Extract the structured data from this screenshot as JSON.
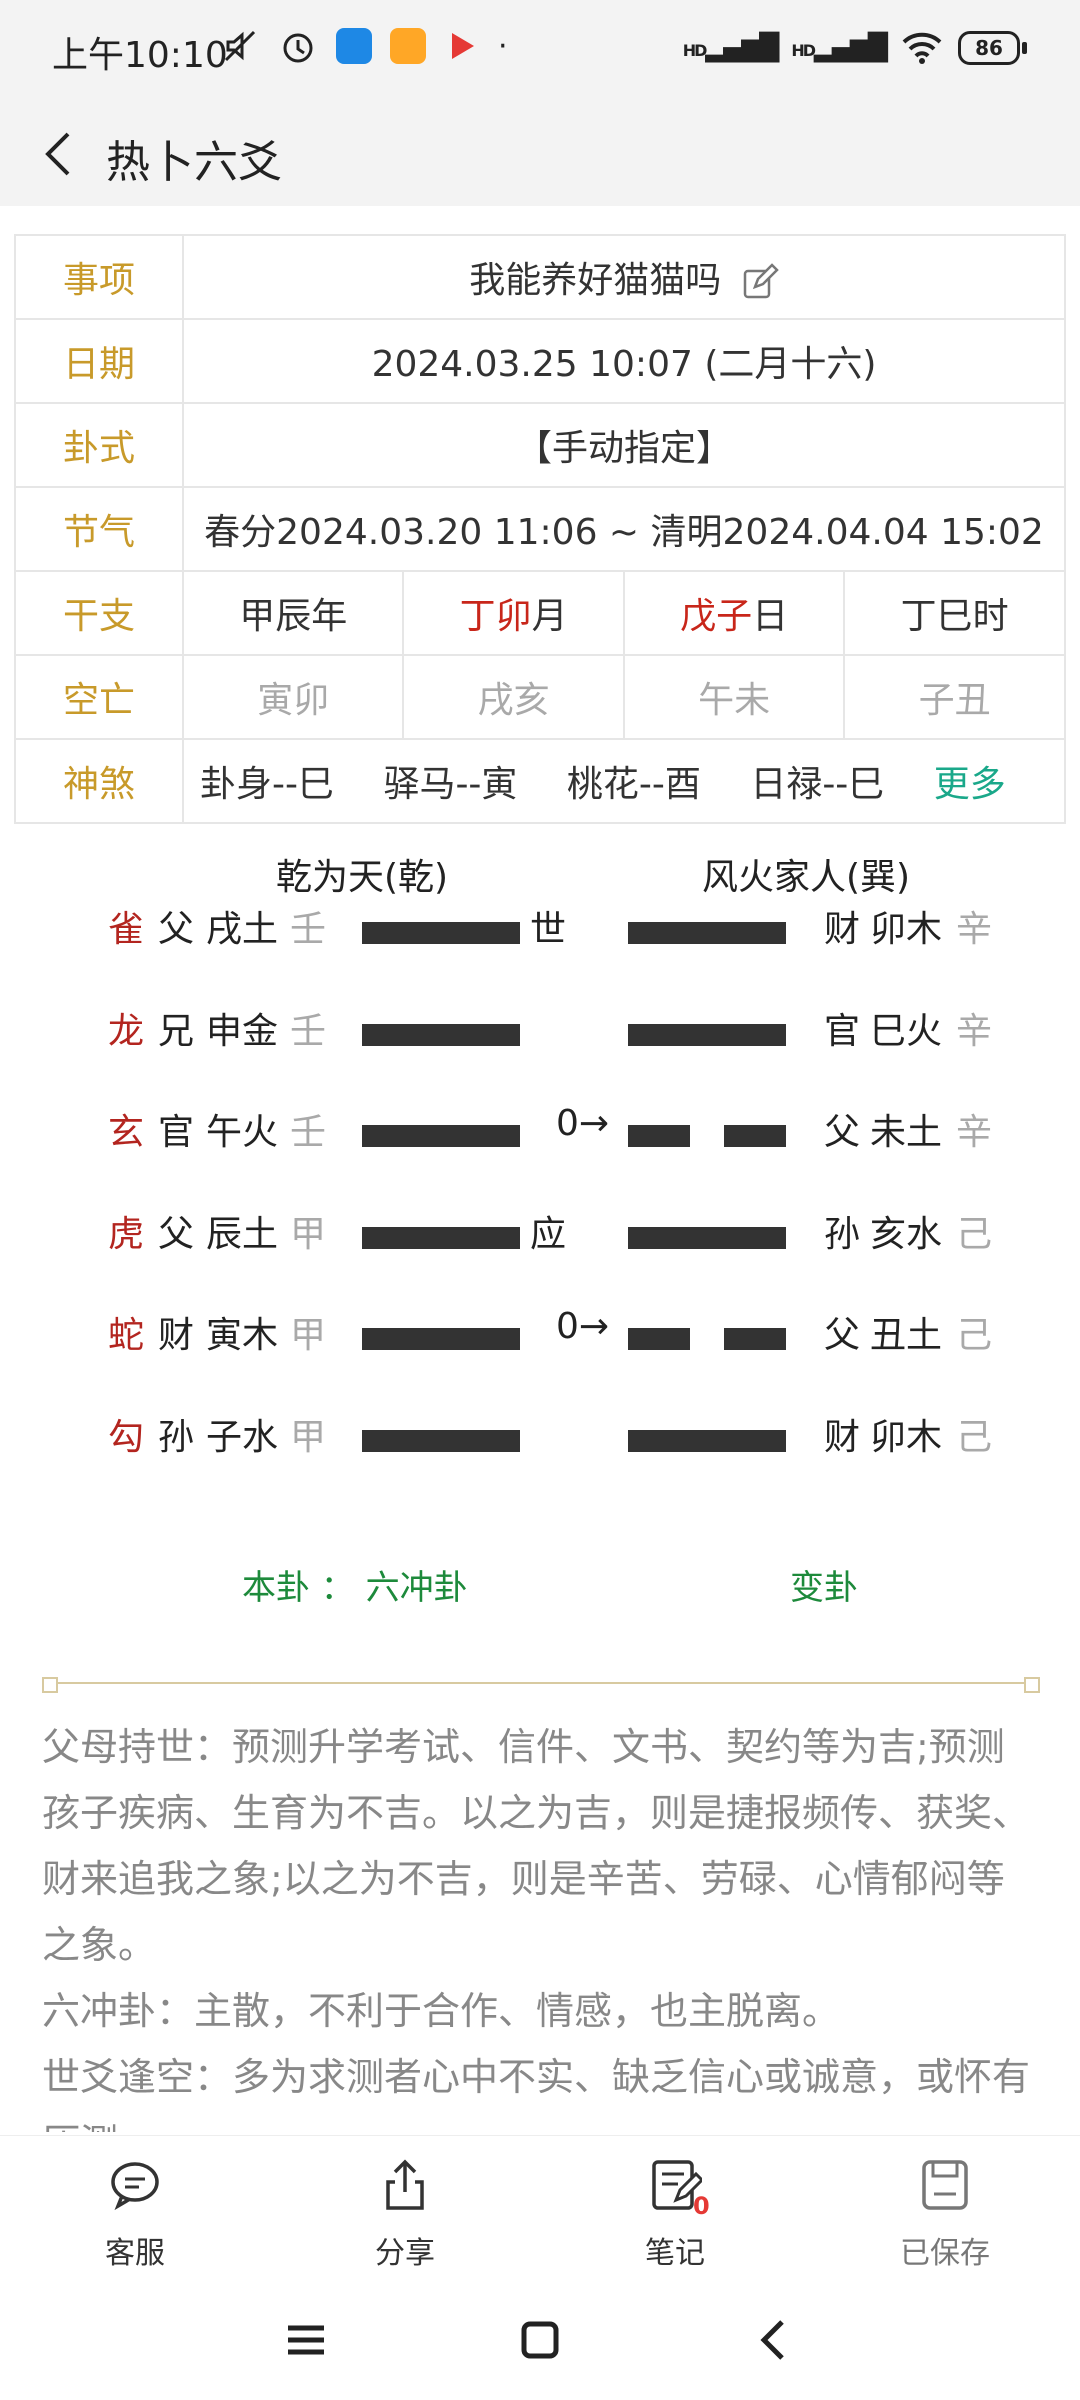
{
  "status_bar": {
    "time": "上午10:10",
    "battery": "86",
    "network": "HD"
  },
  "header": {
    "title": "热卜六爻"
  },
  "info": {
    "item_label": "事项",
    "item_value": "我能养好猫猫吗",
    "date_label": "日期",
    "date_value": "2024.03.25 10:07 (二月十六)",
    "method_label": "卦式",
    "method_value": "【手动指定】",
    "solar_label": "节气",
    "solar_value": "春分2024.03.20 11:06 ~ 清明2024.04.04 15:02",
    "ganzhi_label": "干支",
    "ganzhi": [
      {
        "gz": "甲辰",
        "suffix": "年"
      },
      {
        "gz": "丁卯",
        "suffix": "月"
      },
      {
        "gz": "戊子",
        "suffix": "日"
      },
      {
        "gz": "丁巳",
        "suffix": "时"
      }
    ],
    "void_label": "空亡",
    "void": [
      "寅卯",
      "戌亥",
      "午未",
      "子丑"
    ],
    "shensha_label": "神煞",
    "shensha": [
      "卦身--巳",
      "驿马--寅",
      "桃花--酉",
      "日禄--巳"
    ],
    "more": "更多"
  },
  "hexagram": {
    "main_name": "乾为天(乾)",
    "changed_name": "风火家人(巽)",
    "lines": [
      {
        "god": "雀",
        "rel": "父",
        "branch": "戌土",
        "stem": "壬",
        "main": "yang",
        "mark": "世",
        "changed": "yang",
        "c_rel": "财",
        "c_branch": "卯木",
        "c_stem": "辛"
      },
      {
        "god": "龙",
        "rel": "兄",
        "branch": "申金",
        "stem": "壬",
        "main": "yang",
        "mark": "",
        "changed": "yang",
        "c_rel": "官",
        "c_branch": "巳火",
        "c_stem": "辛"
      },
      {
        "god": "玄",
        "rel": "官",
        "branch": "午火",
        "stem": "壬",
        "main": "yang",
        "mark": "0→",
        "changed": "yin",
        "c_rel": "父",
        "c_branch": "未土",
        "c_stem": "辛"
      },
      {
        "god": "虎",
        "rel": "父",
        "branch": "辰土",
        "stem": "甲",
        "main": "yang",
        "mark": "应",
        "changed": "yang",
        "c_rel": "孙",
        "c_branch": "亥水",
        "c_stem": "己"
      },
      {
        "god": "蛇",
        "rel": "财",
        "branch": "寅木",
        "stem": "甲",
        "main": "yang",
        "mark": "0→",
        "changed": "yin",
        "c_rel": "父",
        "c_branch": "丑土",
        "c_stem": "己"
      },
      {
        "god": "勾",
        "rel": "孙",
        "branch": "子水",
        "stem": "甲",
        "main": "yang",
        "mark": "",
        "changed": "yang",
        "c_rel": "财",
        "c_branch": "卯木",
        "c_stem": "己"
      }
    ],
    "main_foot": "本卦 ： 六冲卦",
    "changed_foot": "变卦"
  },
  "analysis": [
    "父母持世：预测升学考试、信件、文书、契约等为吉;预测孩子疾病、生育为不吉。以之为吉，则是捷报频传、获奖、财来追我之象;以之为不吉，则是辛苦、劳碌、心情郁闷等之象。",
    "六冲卦：主散，不利于合作、情感，也主脱离。",
    "世爻逢空：多为求测者心中不实、缺乏信心或诚意，或怀有压测"
  ],
  "bottom_bar": {
    "service": "客服",
    "share": "分享",
    "notes": "笔记",
    "notes_count": "0",
    "saved": "已保存"
  },
  "colors": {
    "label": "#c89a2a",
    "accent_red": "#c8261a",
    "green": "#1d8a3b",
    "teal": "#1aa88a"
  }
}
